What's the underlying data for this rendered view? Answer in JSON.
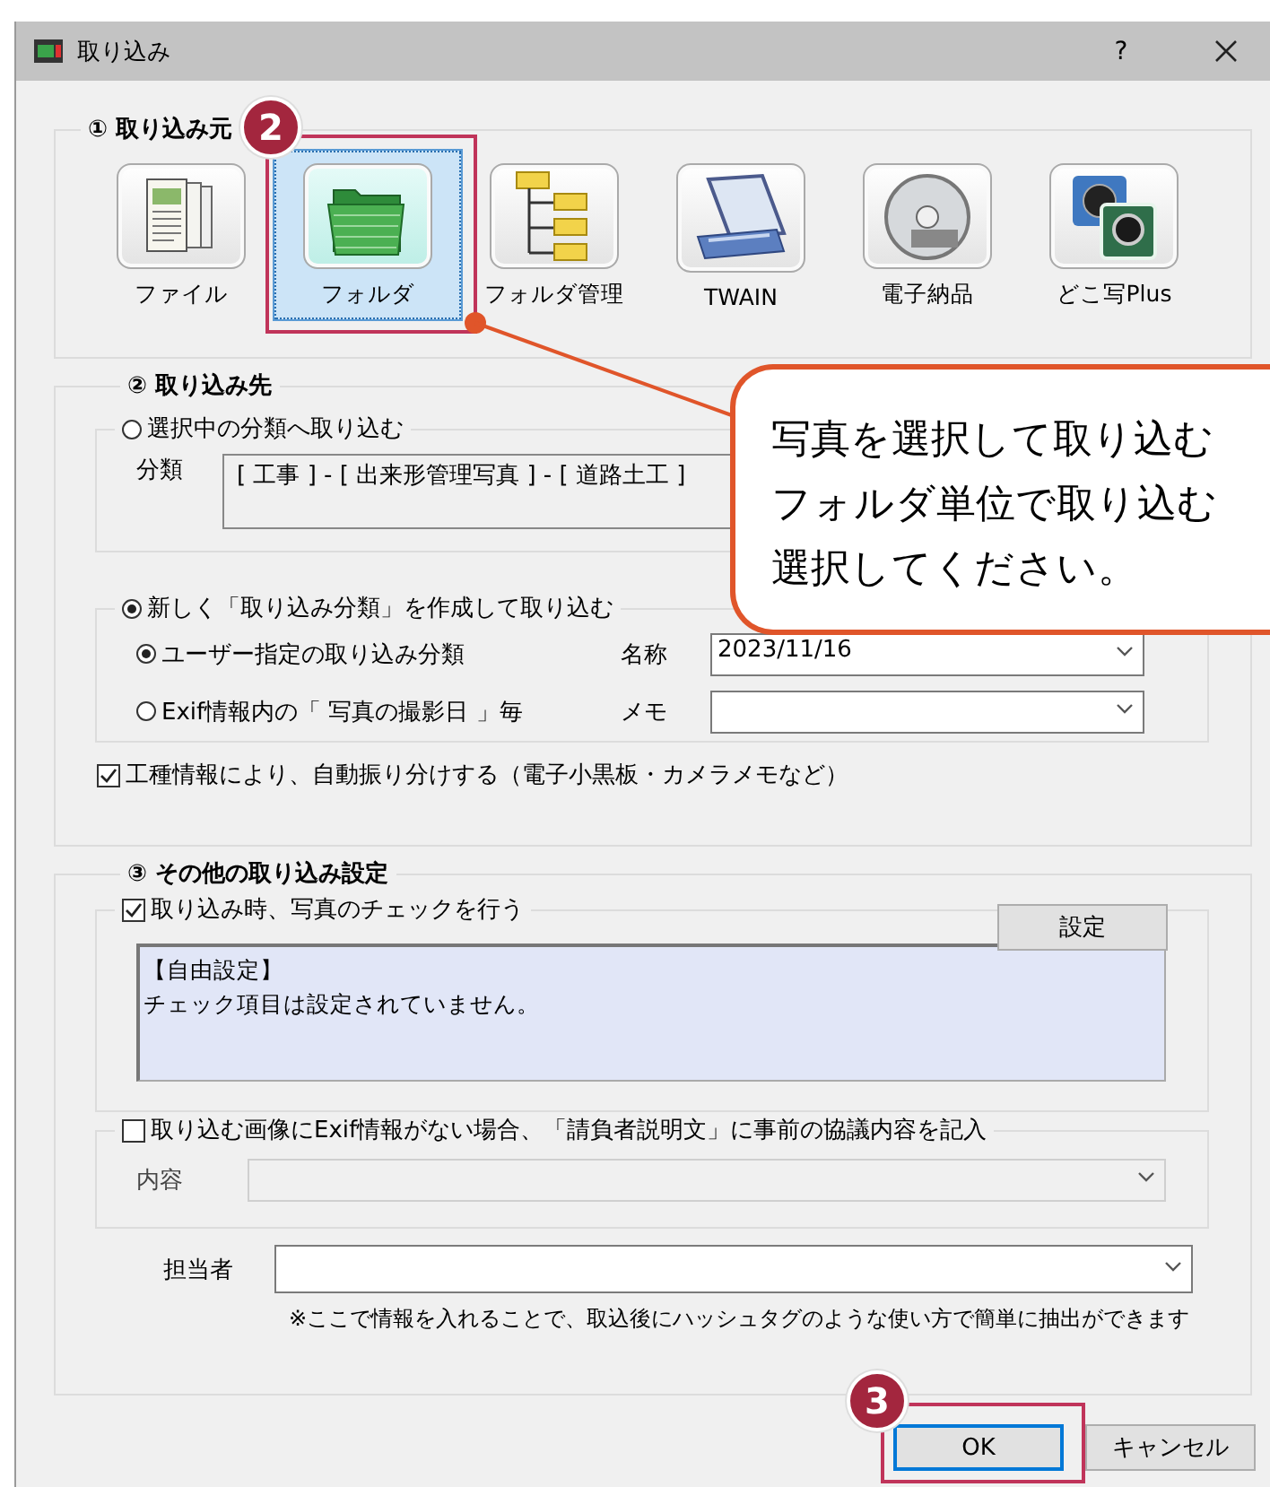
{
  "window": {
    "title": "取り込み",
    "help": "?"
  },
  "source_group": {
    "title": "① 取り込み元",
    "items": [
      {
        "label": "ファイル",
        "kind": "file",
        "selected": false
      },
      {
        "label": "フォルダ",
        "kind": "folder",
        "selected": true
      },
      {
        "label": "フォルダ管理",
        "kind": "tree",
        "selected": false
      },
      {
        "label": "TWAIN",
        "kind": "scanner",
        "selected": false
      },
      {
        "label": "電子納品",
        "kind": "disc",
        "selected": false
      },
      {
        "label": "どこ写Plus",
        "kind": "camera",
        "selected": false
      }
    ]
  },
  "destination_group": {
    "title": "② 取り込み先",
    "existing": {
      "label": "選択中の分類へ取り込む",
      "selected": false,
      "category_label": "分類",
      "category_value": "[ 工事 ] - [ 出来形管理写真 ] - [ 道路土工 ]"
    },
    "new": {
      "label": "新しく「取り込み分類」を作成して取り込む",
      "selected": true,
      "options": [
        {
          "label": "ユーザー指定の取り込み分類",
          "selected": true,
          "field_label": "名称",
          "field_value": "2023/11/16"
        },
        {
          "label": "Exif情報内の「 写真の撮影日 」毎",
          "selected": false,
          "field_label": "メモ"
        }
      ]
    },
    "auto_sort": {
      "label": "工種情報により、自動振り分けする（電子小黒板・カメラメモなど）",
      "checked": true
    }
  },
  "other_group": {
    "title": "③ その他の取り込み設定",
    "photo_check": {
      "label": "取り込み時、写真のチェックを行う",
      "checked": true,
      "button": "設定",
      "summary": [
        "【自由設定】",
        "チェック項目は設定されていません。"
      ]
    },
    "exif_note": {
      "label": "取り込む画像にExif情報がない場合、「請負者説明文」に事前の協議内容を記入",
      "checked": false,
      "field_label": "内容",
      "disabled": true
    },
    "person": {
      "field_label": "担当者",
      "hint": "※ここで情報を入れることで、取込後にハッシュタグのような使い方で簡単に抽出ができます"
    }
  },
  "buttons": [
    {
      "label": "OK",
      "default": true
    },
    {
      "label": "キャンセル",
      "default": false
    }
  ],
  "annotations": {
    "step_badges": [
      "2",
      "3"
    ],
    "callout_lines": [
      "写真を選択して取り込む",
      "フォルダ単位で取り込む",
      "選択してください。"
    ]
  }
}
